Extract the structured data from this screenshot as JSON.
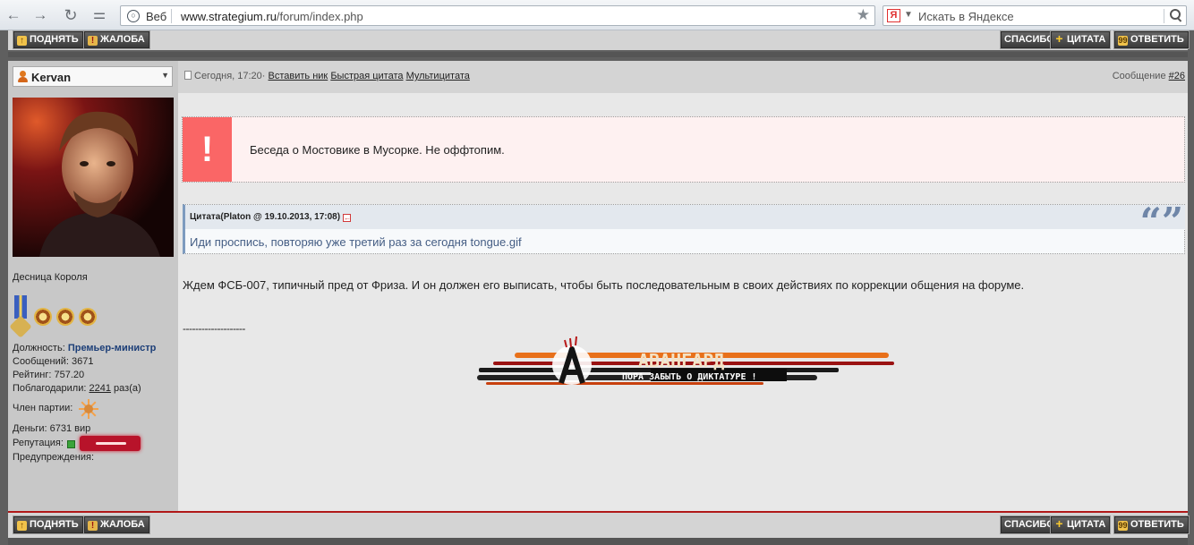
{
  "browser": {
    "back_icon": "back-arrow-icon",
    "forward_icon": "forward-arrow-icon",
    "reload_icon": "reload-icon",
    "key_icon": "key-icon",
    "site_chip": "Веб",
    "url_domain": "www.strategium.ru",
    "url_path": "/forum/index.php",
    "bookmark_icon": "star-icon",
    "search_placeholder": "Искать в Яндексе",
    "search_logo": "Я"
  },
  "toolbar_top": {
    "up_label": "ПОДНЯТЬ",
    "complaint_label": "ЖАЛОБА",
    "thanks_label": "СПАСИБО",
    "quote_label": "ЦИТАТА",
    "reply_label": "ОТВЕТИТЬ"
  },
  "post": {
    "author": "Kervan",
    "meta_time": "Сегодня, 17:20",
    "meta_sep": "·",
    "insert_nick": "Вставить ник",
    "quick_quote": "Быстрая цитата",
    "multi_quote": "Мультицитата",
    "message_label": "Сообщение",
    "message_number": "#26",
    "moderator_note": "Беседа о Мостовике в Мусорке. Не оффтопим.",
    "quote": {
      "title": "Цитата(Platon @ 19.10.2013, 17:08)",
      "text": "Иди проспись, повторяю уже третий раз за сегодня tongue.gif",
      "marks": "“”"
    },
    "body": "Ждем ФСБ-007, типичный пред от Фриза. И он должен его выписать, чтобы быть последовательным в своих действиях по коррекции общения на форуме.",
    "signature_separator": "--------------------",
    "banner_title": "АВАНГАРД",
    "banner_subtitle": "ПОРА ЗАБЫТЬ О ДИКТАТУРЕ !"
  },
  "profile": {
    "title": "Десница Короля",
    "position_label": "Должность:",
    "position_value": "Премьер-министр",
    "messages_label": "Сообщений:",
    "messages_value": "3671",
    "rating_label": "Рейтинг:",
    "rating_value": "757.20",
    "thanked_label": "Поблагодарили:",
    "thanked_value": "2241",
    "thanked_suffix": "раз(а)",
    "party_label": "Член партии:",
    "money_label": "Деньги:",
    "money_value": "6731 вир",
    "reputation_label": "Репутация:",
    "warnings_label": "Предупреждения:"
  },
  "toolbar_bottom": {
    "up_label": "ПОДНЯТЬ",
    "complaint_label": "ЖАЛОБА",
    "thanks_label": "СПАСИБО",
    "quote_label": "ЦИТАТА",
    "reply_label": "ОТВЕТИТЬ"
  },
  "colors": {
    "moderator_icon": "#fa6666",
    "quote_text": "#445d84",
    "link_blue": "#1d3f78",
    "button_dark": "#3b3b3b"
  }
}
